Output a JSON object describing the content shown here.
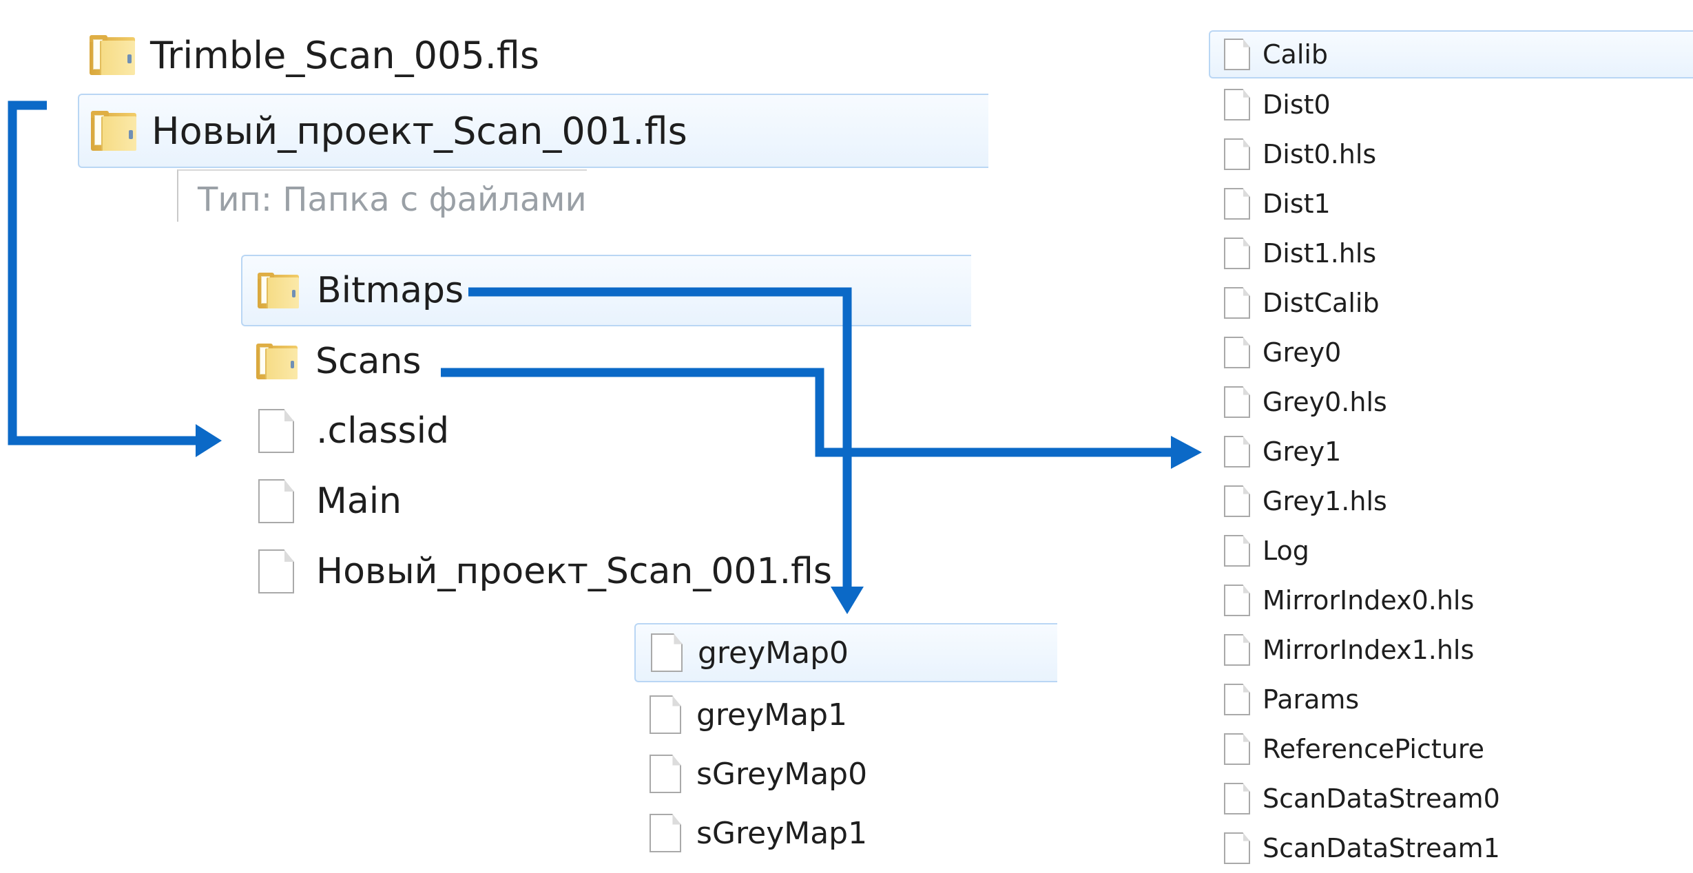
{
  "top_listing": {
    "items": [
      {
        "label": "Trimble_Scan_005.fls",
        "icon": "folder-icon",
        "selected": false
      },
      {
        "label": "Новый_проект_Scan_001.fls",
        "icon": "folder-icon",
        "selected": true
      }
    ],
    "tooltip": "Тип: Папка с файлами"
  },
  "project_folder": {
    "items": [
      {
        "label": "Bitmaps",
        "icon": "folder-icon",
        "selected": true
      },
      {
        "label": "Scans",
        "icon": "folder-icon",
        "selected": false
      },
      {
        "label": ".classid",
        "icon": "file-icon",
        "selected": false
      },
      {
        "label": "Main",
        "icon": "file-icon",
        "selected": false
      },
      {
        "label": "Новый_проект_Scan_001.fls",
        "icon": "file-icon",
        "selected": false
      }
    ]
  },
  "bitmaps_folder": {
    "items": [
      {
        "label": "greyMap0",
        "icon": "file-icon",
        "selected": true
      },
      {
        "label": "greyMap1",
        "icon": "file-icon",
        "selected": false
      },
      {
        "label": "sGreyMap0",
        "icon": "file-icon",
        "selected": false
      },
      {
        "label": "sGreyMap1",
        "icon": "file-icon",
        "selected": false
      }
    ]
  },
  "scans_folder": {
    "items": [
      {
        "label": "Calib",
        "icon": "file-icon",
        "selected": true
      },
      {
        "label": "Dist0",
        "icon": "file-icon",
        "selected": false
      },
      {
        "label": "Dist0.hls",
        "icon": "file-icon",
        "selected": false
      },
      {
        "label": "Dist1",
        "icon": "file-icon",
        "selected": false
      },
      {
        "label": "Dist1.hls",
        "icon": "file-icon",
        "selected": false
      },
      {
        "label": "DistCalib",
        "icon": "file-icon",
        "selected": false
      },
      {
        "label": "Grey0",
        "icon": "file-icon",
        "selected": false
      },
      {
        "label": "Grey0.hls",
        "icon": "file-icon",
        "selected": false
      },
      {
        "label": "Grey1",
        "icon": "file-icon",
        "selected": false
      },
      {
        "label": "Grey1.hls",
        "icon": "file-icon",
        "selected": false
      },
      {
        "label": "Log",
        "icon": "file-icon",
        "selected": false
      },
      {
        "label": "MirrorIndex0.hls",
        "icon": "file-icon",
        "selected": false
      },
      {
        "label": "MirrorIndex1.hls",
        "icon": "file-icon",
        "selected": false
      },
      {
        "label": "Params",
        "icon": "file-icon",
        "selected": false
      },
      {
        "label": "ReferencePicture",
        "icon": "file-icon",
        "selected": false
      },
      {
        "label": "ScanDataStream0",
        "icon": "file-icon",
        "selected": false
      },
      {
        "label": "ScanDataStream1",
        "icon": "file-icon",
        "selected": false
      }
    ]
  },
  "colors": {
    "arrow": "#0b69c7",
    "selection_border": "#b9d6f4",
    "selection_fill": "#eaf3fd",
    "text": "#1e1e1e",
    "tooltip_text": "#9aa0a6"
  }
}
